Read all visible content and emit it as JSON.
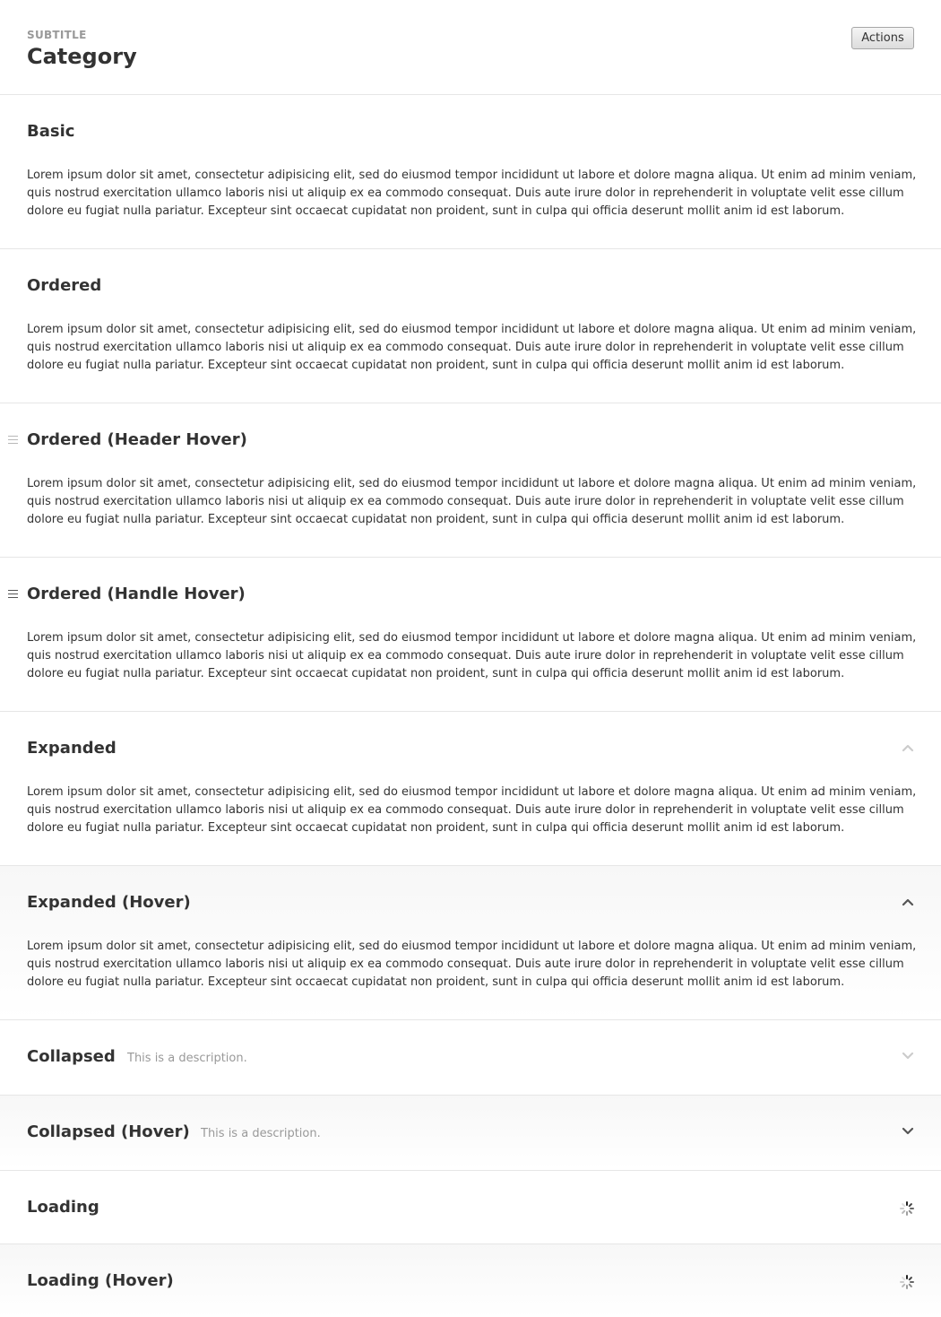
{
  "header": {
    "subtitle": "SUBTITLE",
    "title": "Category",
    "actions_label": "Actions"
  },
  "lorem": "Lorem ipsum dolor sit amet, consectetur adipisicing elit, sed do eiusmod tempor incididunt ut labore et dolore magna aliqua. Ut enim ad minim veniam, quis nostrud exercitation ullamco laboris nisi ut aliquip ex ea commodo consequat. Duis aute irure dolor in reprehenderit in voluptate velit esse cillum dolore eu fugiat nulla pariatur. Excepteur sint occaecat cupidatat non proident, sunt in culpa qui officia deserunt mollit anim id est laborum.",
  "sections": [
    {
      "title": "Basic"
    },
    {
      "title": "Ordered"
    },
    {
      "title": "Ordered (Header Hover)"
    },
    {
      "title": "Ordered (Handle Hover)"
    },
    {
      "title": "Expanded",
      "icon": "chevron-up-icon"
    },
    {
      "title": "Expanded (Hover)",
      "icon": "chevron-up-icon"
    },
    {
      "title": "Collapsed",
      "description": "This is a description.",
      "icon": "chevron-down-icon"
    },
    {
      "title": "Collapsed (Hover)",
      "description": "This is a description.",
      "icon": "chevron-down-icon"
    },
    {
      "title": "Loading",
      "icon": "loading-spinner-icon"
    },
    {
      "title": "Loading (Hover)",
      "icon": "loading-spinner-icon"
    }
  ],
  "colors": {
    "title_text": "#333333",
    "muted_text": "#999999",
    "divider": "#e6e6e6",
    "hover_background": "#f7f7f7"
  }
}
